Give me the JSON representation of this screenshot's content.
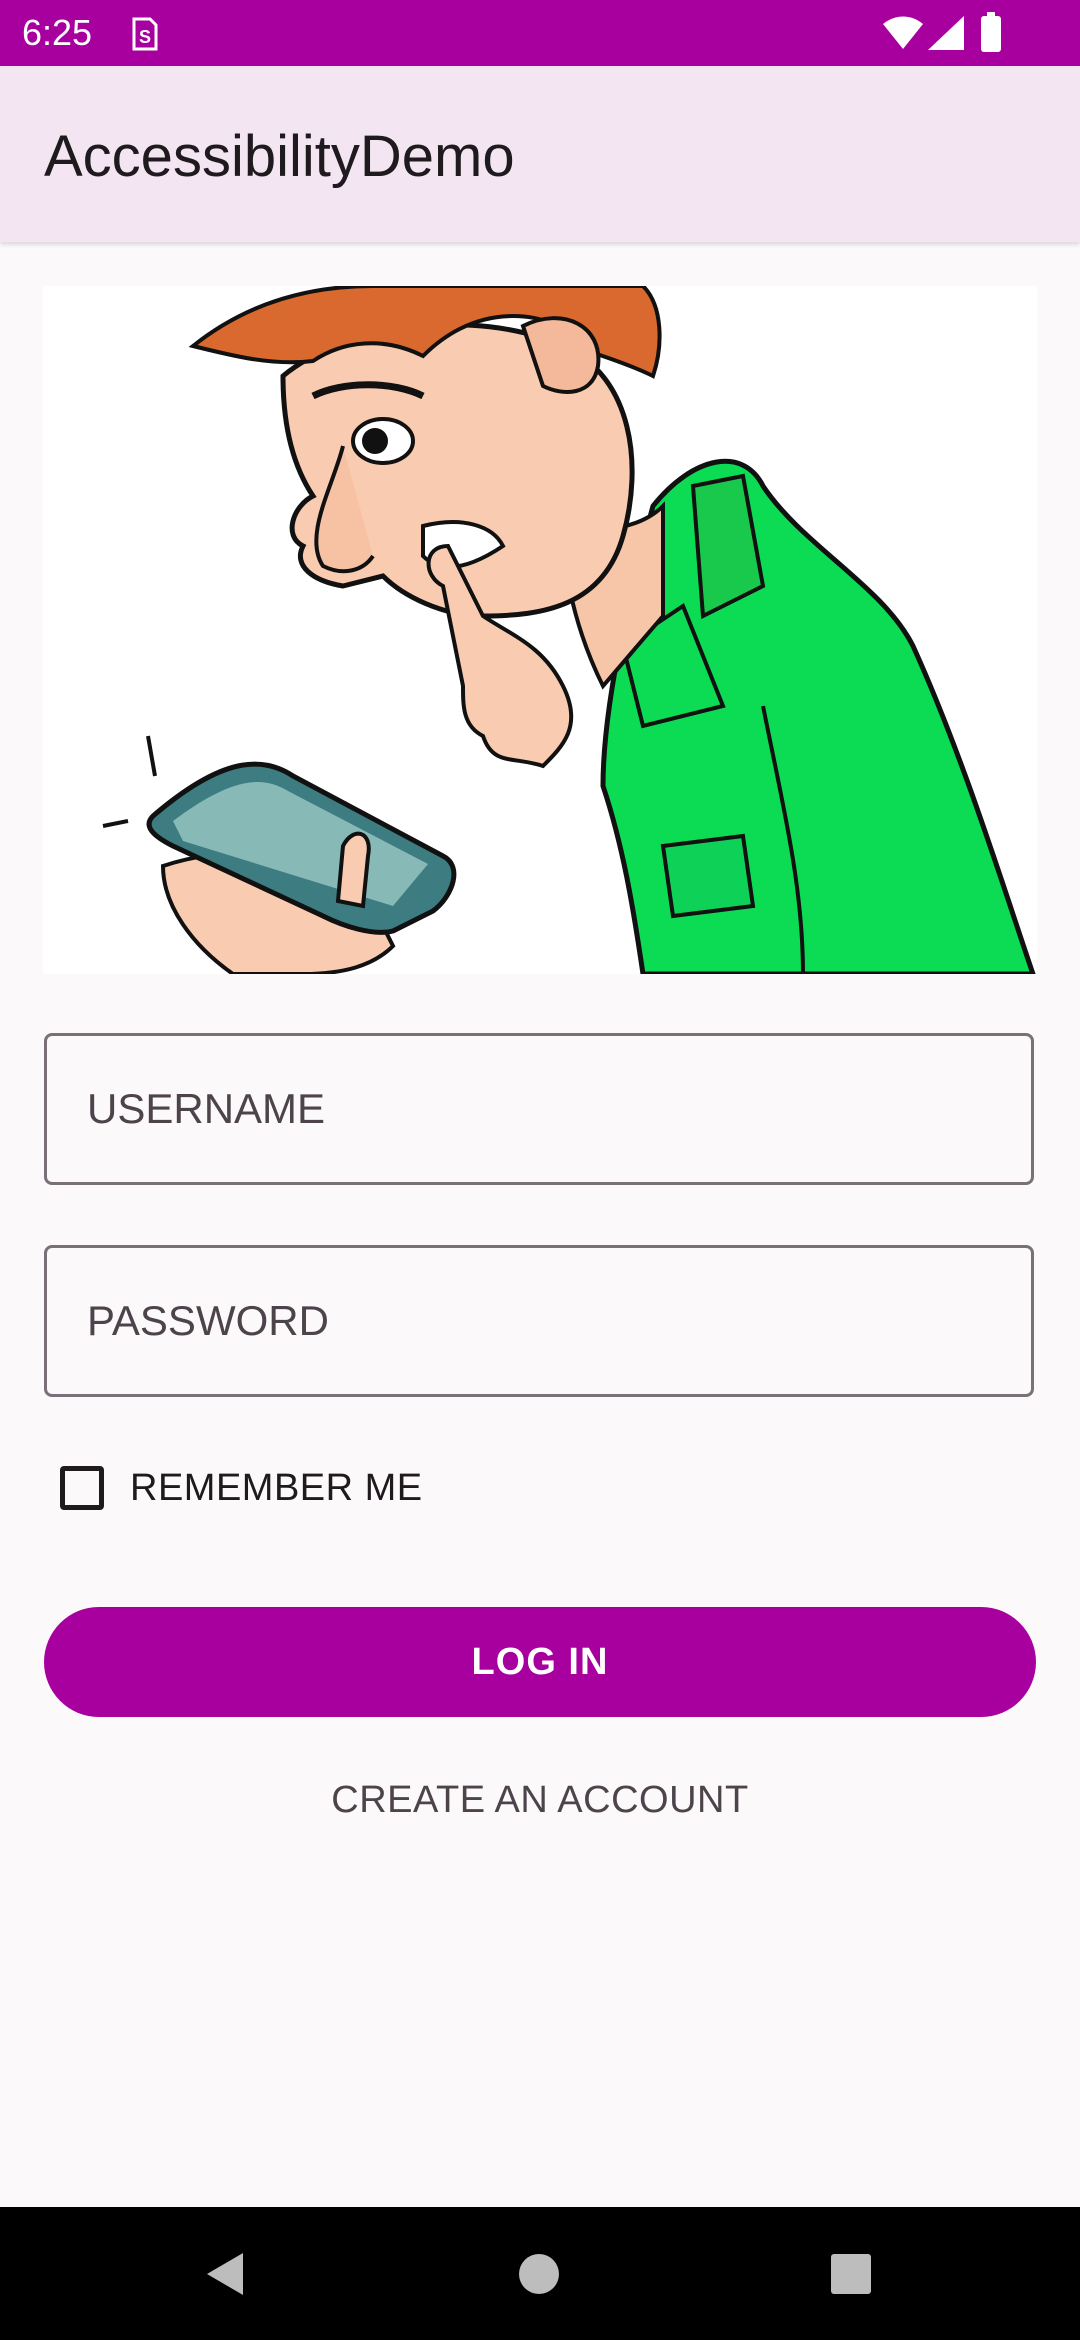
{
  "status_bar": {
    "time": "6:25",
    "icons": [
      "sim-card-icon",
      "wifi-icon",
      "cell-signal-icon",
      "battery-icon"
    ]
  },
  "app_bar": {
    "title": "AccessibilityDemo"
  },
  "illustration": {
    "icon": "man-looking-at-phone-illustration"
  },
  "form": {
    "username_placeholder": "USERNAME",
    "username_value": "",
    "password_placeholder": "PASSWORD",
    "password_value": "",
    "remember_me_label": "REMEMBER ME",
    "remember_me_checked": false,
    "login_label": "LOG IN",
    "create_account_label": "CREATE AN ACCOUNT"
  },
  "nav_bar": {
    "buttons": [
      "back-icon",
      "home-icon",
      "recents-icon"
    ]
  },
  "colors": {
    "primary": "#a8009f",
    "app_bar": "#f3e6f2",
    "background": "#fcf9fb",
    "shirt_green": "#0bdc54",
    "hair": "#d9692e"
  }
}
